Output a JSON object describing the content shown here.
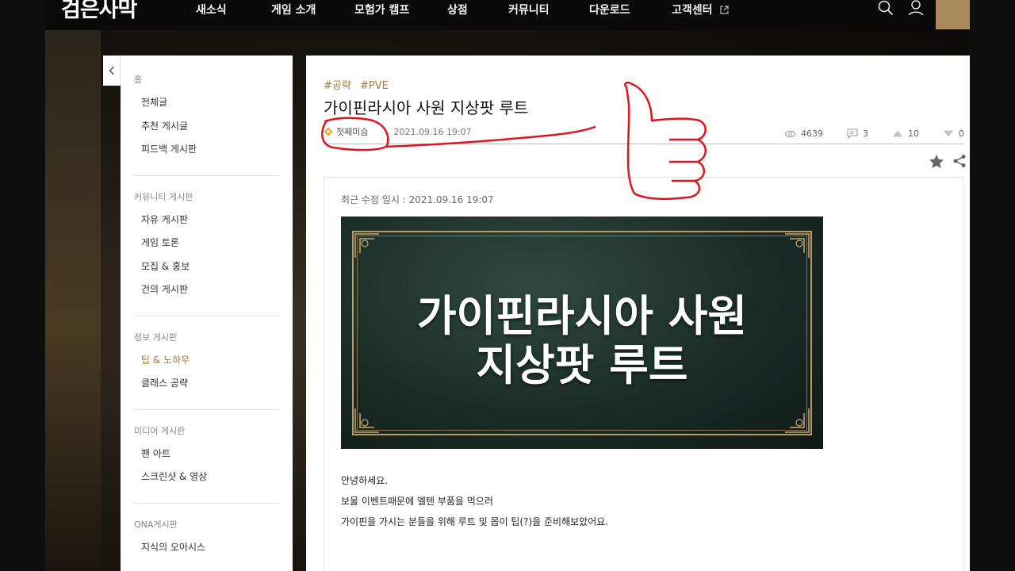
{
  "header": {
    "logo": "검은사막",
    "nav": [
      {
        "label": "새소식"
      },
      {
        "label": "게임 소개"
      },
      {
        "label": "모험가 캠프"
      },
      {
        "label": "상점"
      },
      {
        "label": "커뮤니티"
      },
      {
        "label": "다운로드"
      },
      {
        "label": "고객센터",
        "external": true
      }
    ],
    "icons": [
      "search-icon",
      "user-icon"
    ],
    "accent": "#a98a5b"
  },
  "sidebar": {
    "groups": [
      {
        "title": "홈",
        "items": [
          "전체글",
          "추천 게시글",
          "피드백 게시판"
        ]
      },
      {
        "title": "커뮤니티 게시판",
        "items": [
          "자유 게시판",
          "게임 토론",
          "모집 & 홍보",
          "건의 게시판"
        ]
      },
      {
        "title": "정보 게시판",
        "items": [
          "팁 & 노하우",
          "클래스 공략"
        ],
        "active": "팁 & 노하우"
      },
      {
        "title": "미디어 게시판",
        "items": [
          "팬 아트",
          "스크린샷 & 영상"
        ]
      },
      {
        "title": "QNA게시판",
        "items": [
          "지식의 오아시스"
        ]
      }
    ]
  },
  "post": {
    "tags": [
      "#공략",
      "#PVE"
    ],
    "title": "가이핀라시아 사원 지상팟 루트",
    "author": "첫째미슴",
    "date": "2021.09.16 19:07",
    "views": "4639",
    "comments": "3",
    "upvotes": "10",
    "downvotes": "0",
    "edited": "최근 수정 일시 : 2021.09.16 19:07",
    "banner_lines": [
      "가이핀라시아 사원",
      "지상팟 루트"
    ],
    "body": [
      "안녕하세요.",
      "보물 이벤트때문에 엘텐 부품을 먹으러",
      "가이핀을 가시는 분들을 위해 루트 및 몹이 팁(?)을 준비해보았어요."
    ]
  },
  "colors": {
    "tag": "#a47a3a",
    "annotation": "#e0141e",
    "active": "#a67c2e"
  }
}
